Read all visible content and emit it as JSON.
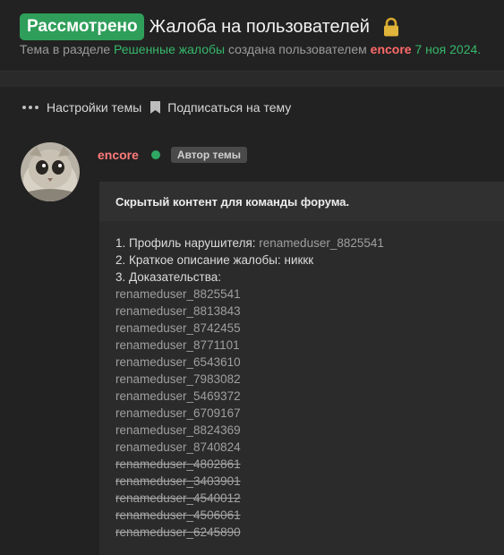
{
  "thread": {
    "status": "Рассмотрено",
    "title": "Жалоба на пользователей",
    "subline": {
      "prefix": "Тема в разделе",
      "section": "Решенные жалобы",
      "middle": "создана пользователем",
      "author": "encore",
      "date": "7 ноя 2024."
    }
  },
  "actions": {
    "settings": "Настройки темы",
    "subscribe": "Подписаться на тему"
  },
  "post": {
    "author": "encore",
    "badge": "Автор темы",
    "hidden_notice": "Скрытый контент для команды форума.",
    "line1_label": "1. Профиль нарушителя:",
    "line1_value": "renameduser_8825541",
    "line2": "2. Краткое описание жалобы: никкк",
    "line3": "3. Доказательства:",
    "evidence": [
      "renameduser_8825541",
      "renameduser_8813843",
      "renameduser_8742455",
      "renameduser_8771101",
      "renameduser_6543610",
      "renameduser_7983082",
      "renameduser_5469372",
      "renameduser_6709167",
      "renameduser_8824369",
      "renameduser_8740824"
    ],
    "evidence_struck": [
      "renameduser_4802861",
      "renameduser_3403901",
      "renameduser_4540012",
      "renameduser_4506061",
      "renameduser_6245890"
    ]
  },
  "colors": {
    "accent_green": "#2f9e5a",
    "author_red": "#ff6a6a",
    "background": "#222222"
  }
}
